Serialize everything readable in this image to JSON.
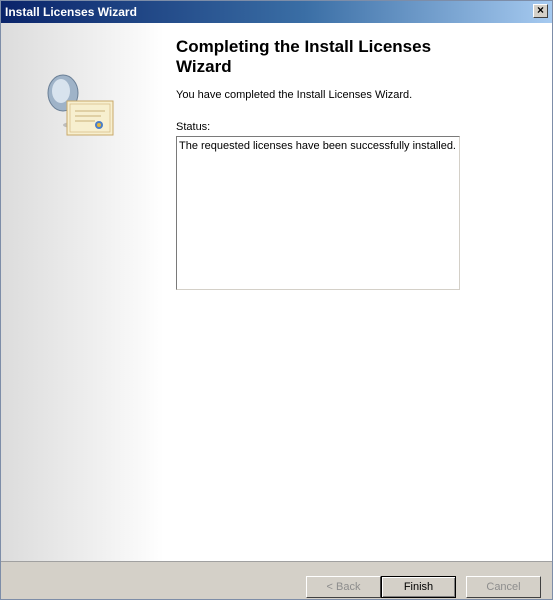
{
  "window": {
    "title": "Install Licenses Wizard",
    "close_icon": "close-icon",
    "close_glyph": "×"
  },
  "left_panel": {
    "art_icon": "certificate-icon"
  },
  "content": {
    "heading": "Completing the Install Licenses Wizard",
    "description": "You have completed the Install Licenses Wizard.",
    "status_label": "Status:",
    "status_text": "The requested licenses have been successfully installed."
  },
  "buttons": {
    "back": "< Back",
    "finish": "Finish",
    "cancel": "Cancel"
  },
  "colors": {
    "titlebar_start": "#0a246a",
    "titlebar_end": "#a6caf0",
    "button_face": "#d4d0c8",
    "disabled_text": "#8d8d8d"
  }
}
